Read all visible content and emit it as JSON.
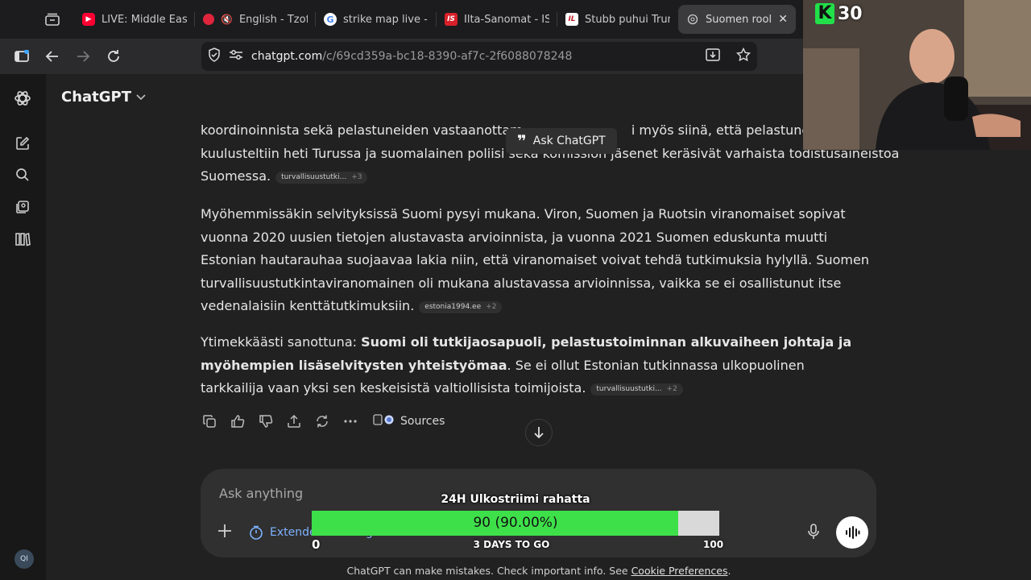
{
  "browser": {
    "tabs": [
      {
        "label": "LIVE: Middle East",
        "icon": "youtube-icon",
        "color": "#ff0033"
      },
      {
        "label": "English - Tzof",
        "icon": "audio-muted-icon",
        "color": "#e0243c"
      },
      {
        "label": "strike map live - G",
        "icon": "google-icon",
        "color": "#4285f4"
      },
      {
        "label": "Ilta-Sanomat - IS",
        "icon": "is-logo-icon",
        "color": "#d8202a"
      },
      {
        "label": "Stubb puhui Trum",
        "icon": "il-logo-icon",
        "color": "#c21f2a"
      },
      {
        "label": "Suomen rooli E",
        "icon": "chatgpt-icon",
        "color": "#cccccc"
      }
    ],
    "url_host": "chatgpt.com",
    "url_path": "/c/69cd359a-bc18-8390-af7c-2f6088078248"
  },
  "app": {
    "name": "ChatGPT",
    "tooltip": "Ask ChatGPT"
  },
  "message": {
    "p1_line1": "koordinoinnista sekä pelastuneiden vastaanottam",
    "p1_line1_tail": "i myös siinä, että pelastuneita",
    "p1_line2": "kuulusteltiin heti Turussa ja suomalainen poliisi seka komission jäsenet keräsivät varhaista todistusaineistoa",
    "p1_line3": "Suomessa.",
    "p1_chip": "turvallisuustutki...",
    "p1_chip_more": "+3",
    "p2": "Myöhemmissäkin selvityksissä Suomi pysyi mukana. Viron, Suomen ja Ruotsin viranomaiset sopivat vuonna 2020 uusien tietojen alustavasta arvioinnista, ja vuonna 2021 Suomen eduskunta muutti Estonian hautarauhaa suojaavaa lakia niin, että viranomaiset voivat tehdä tutkimuksia hylyllä. Suomen turvallisuustutkintaviranomainen oli mukana alustavassa arvioinnissa, vaikka se ei osallistunut itse vedenalaisiin kenttätutkimuksiin.",
    "p2_chip": "estonia1994.ee",
    "p2_chip_more": "+2",
    "p3_lead": "Ytimekkäästi sanottuna: ",
    "p3_bold": "Suomi oli tutkijaosapuoli, pelastustoiminnan alkuvaiheen johtaja ja myöhempien lisäselvitysten yhteistyömaa",
    "p3_rest": ". Se ei ollut Estonian tutkinnassa ulkopuolinen tarkkailija vaan yksi sen keskeisistä valtiollisista toimijoista.",
    "p3_chip": "turvallisuustutki...",
    "p3_chip_more": "+2",
    "sources_label": "Sources"
  },
  "composer": {
    "placeholder": "Ask anything",
    "mode_label": "Extended thinking"
  },
  "footer": {
    "text": "ChatGPT can make mistakes. Check important info. See ",
    "link": "Cookie Preferences",
    "end": "."
  },
  "user_badge": "QI",
  "overlay": {
    "title": "24H Ulkostriimi rahatta",
    "value_label": "90 (90.00%)",
    "progress_fraction": 0.9,
    "min_label": "0",
    "max_label": "100",
    "sub_label": "3 DAYS TO GO",
    "fill_color": "#3ee04a"
  },
  "webcam": {
    "badge_letter": "K",
    "badge_number": "30"
  }
}
